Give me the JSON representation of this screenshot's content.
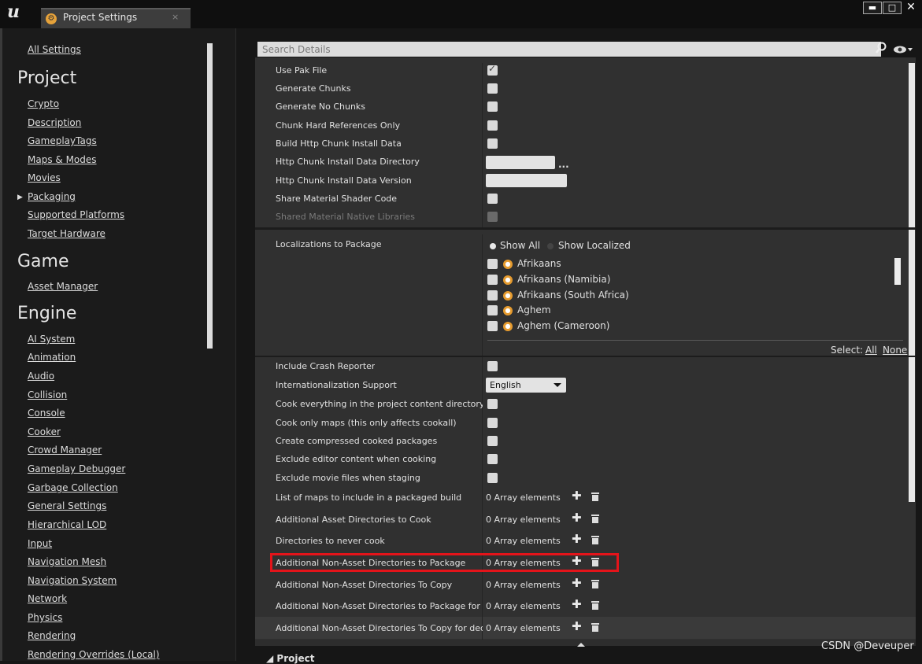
{
  "window": {
    "tab_title": "Project Settings",
    "tab_close": "×",
    "controls": {
      "minimize": "▬",
      "maximize": "□",
      "close": "✕"
    }
  },
  "sidebar": {
    "all_settings": "All Settings",
    "project_heading": "Project",
    "project_items": [
      "Crypto",
      "Description",
      "GameplayTags",
      "Maps & Modes",
      "Movies",
      "Packaging",
      "Supported Platforms",
      "Target Hardware"
    ],
    "game_heading": "Game",
    "game_items": [
      "Asset Manager"
    ],
    "engine_heading": "Engine",
    "engine_items": [
      "AI System",
      "Animation",
      "Audio",
      "Collision",
      "Console",
      "Cooker",
      "Crowd Manager",
      "Gameplay Debugger",
      "Garbage Collection",
      "General Settings",
      "Hierarchical LOD",
      "Input",
      "Navigation Mesh",
      "Navigation System",
      "Network",
      "Physics",
      "Rendering",
      "Rendering Overrides (Local)"
    ]
  },
  "search": {
    "placeholder": "Search Details"
  },
  "properties_top": [
    {
      "label": "Use Pak File",
      "checked": true
    },
    {
      "label": "Generate Chunks",
      "checked": false
    },
    {
      "label": "Generate No Chunks",
      "checked": false
    },
    {
      "label": "Chunk Hard References Only",
      "checked": false
    },
    {
      "label": "Build Http Chunk Install Data",
      "checked": false
    },
    {
      "label": "Http Chunk Install Data Directory"
    },
    {
      "label": "Http Chunk Install Data Version"
    },
    {
      "label": "Share Material Shader Code",
      "checked": false
    },
    {
      "label": "Shared Material Native Libraries",
      "checked": false,
      "disabled": true
    }
  ],
  "browse_dots": "...",
  "localizations": {
    "label": "Localizations to Package",
    "show_all": "Show All",
    "show_localized": "Show Localized",
    "cultures": [
      "Afrikaans",
      "Afrikaans (Namibia)",
      "Afrikaans (South Africa)",
      "Aghem",
      "Aghem (Cameroon)"
    ],
    "select_label": "Select:",
    "select_all": "All",
    "select_none": "None"
  },
  "properties_mid": [
    {
      "label": "Include Crash Reporter",
      "checked": false
    },
    {
      "label": "Internationalization Support",
      "value": "English"
    },
    {
      "label": "Cook everything in the project content directory (ignore list of maps below)",
      "checked": false
    },
    {
      "label": "Cook only maps (this only affects cookall)",
      "checked": false
    },
    {
      "label": "Create compressed cooked packages",
      "checked": false
    },
    {
      "label": "Exclude editor content when cooking",
      "checked": false
    },
    {
      "label": "Exclude movie files when staging",
      "checked": false
    }
  ],
  "array_props": [
    {
      "label": "List of maps to include in a packaged build",
      "value": "0 Array elements"
    },
    {
      "label": "Additional Asset Directories to Cook",
      "value": "0 Array elements"
    },
    {
      "label": "Directories to never cook",
      "value": "0 Array elements"
    },
    {
      "label": "Additional Non-Asset Directories to Package",
      "value": "0 Array elements"
    },
    {
      "label": "Additional Non-Asset Directories To Copy",
      "value": "0 Array elements"
    },
    {
      "label": "Additional Non-Asset Directories to Package for dedicated server only",
      "value": "0 Array elements"
    },
    {
      "label": "Additional Non-Asset Directories To Copy for dedicated server only",
      "value": "0 Array elements"
    }
  ],
  "footer": {
    "project": "◢ Project"
  },
  "watermark": "CSDN @Deveuper"
}
